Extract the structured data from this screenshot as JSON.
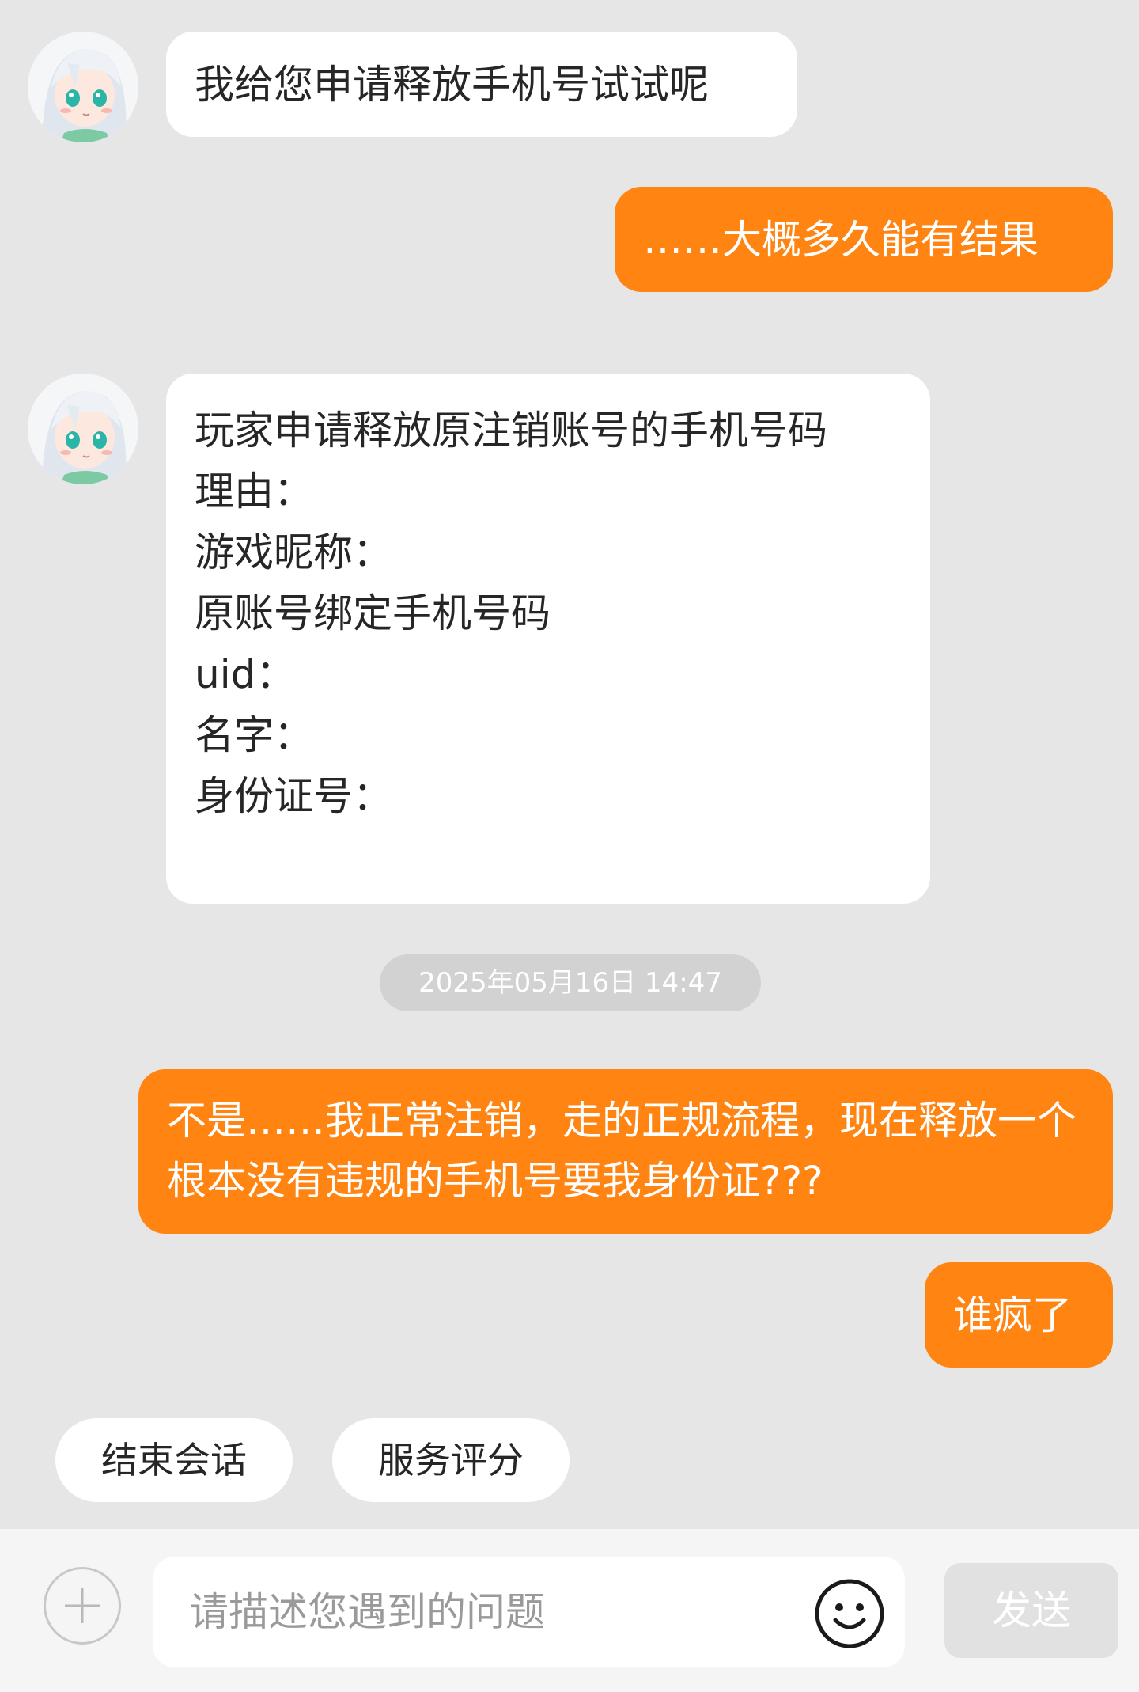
{
  "messages": [
    {
      "sender": "agent",
      "text": "我给您申请释放手机号试试呢"
    },
    {
      "sender": "user",
      "text": "……大概多久能有结果"
    },
    {
      "sender": "agent",
      "text": "玩家申请释放原注销账号的手机号码\n理由：\n游戏昵称：\n原账号绑定手机号码\nuid：\n名字：\n身份证号：\n"
    },
    {
      "sender": "user",
      "text": "不是……我正常注销，走的正规流程，现在释放一个根本没有违规的手机号要我身份证???"
    },
    {
      "sender": "user",
      "text": "谁疯了"
    }
  ],
  "timestamp": "2025年05月16日 14:47",
  "quick_actions": {
    "end_session": "结束会话",
    "rate_service": "服务评分"
  },
  "composer": {
    "placeholder": "请描述您遇到的问题",
    "send_label": "发送"
  },
  "icons": {
    "add": "plus-circle-icon",
    "emoji": "smiley-icon",
    "avatar": "anime-avatar"
  },
  "colors": {
    "background": "#e6e6e6",
    "user_bubble": "#ff8412",
    "agent_bubble": "#ffffff",
    "send_disabled": "#e1e1e1"
  }
}
